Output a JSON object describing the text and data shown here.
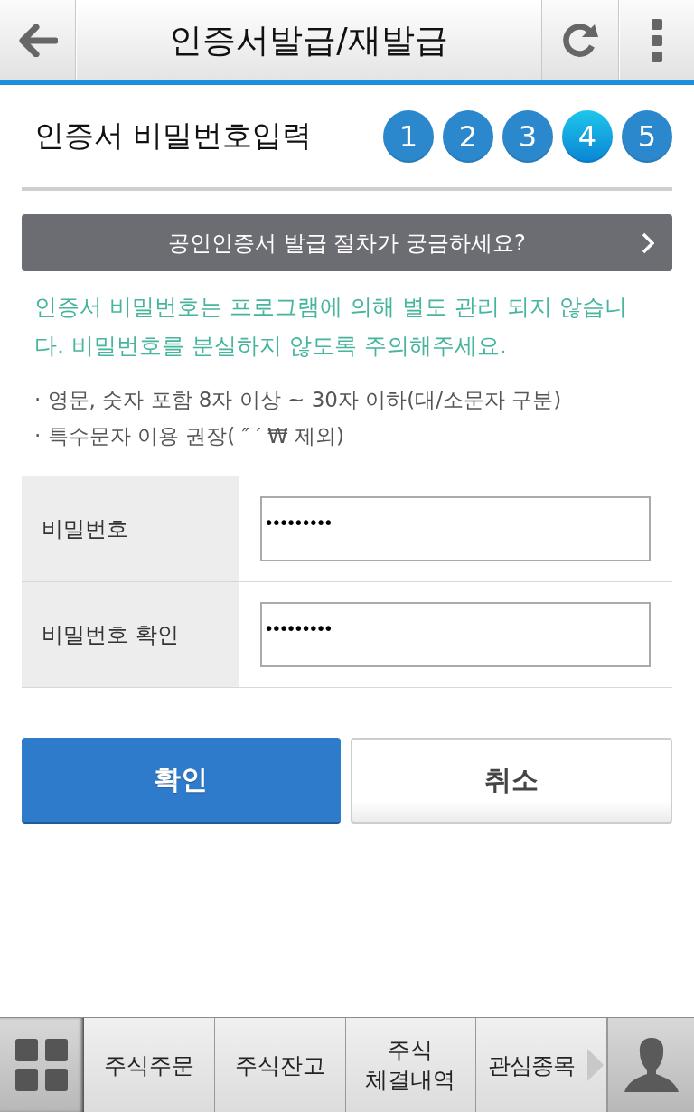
{
  "header": {
    "title": "인증서발급/재발급"
  },
  "section": {
    "title": "인증서 비밀번호입력",
    "steps": [
      {
        "label": "1",
        "selected": false
      },
      {
        "label": "2",
        "selected": false
      },
      {
        "label": "3",
        "selected": false
      },
      {
        "label": "4",
        "selected": true
      },
      {
        "label": "5",
        "selected": false
      }
    ]
  },
  "help_banner": {
    "label": "공인인증서 발급 절차가 궁금하세요?"
  },
  "notice": "인증서 비밀번호는 프로그램에 의해 별도 관리 되지 않습니다. 비밀번호를 분실하지 않도록 주의해주세요.",
  "rules": [
    "· 영문, 숫자 포함 8자 이상 ~ 30자 이하(대/소문자 구분)",
    "· 특수문자 이용 권장( ″ ′ ₩ 제외)"
  ],
  "fields": [
    {
      "label": "비밀번호",
      "value": "•••••••••"
    },
    {
      "label": "비밀번호 확인",
      "value": "•••••••••"
    }
  ],
  "buttons": [
    {
      "label": "확인",
      "kind": "primary"
    },
    {
      "label": "취소",
      "kind": "secondary"
    }
  ],
  "bottom_nav": {
    "items": [
      {
        "label": "주식주문",
        "more": false
      },
      {
        "label": "주식잔고",
        "more": false
      },
      {
        "label": "주식 체결내역",
        "more": false
      },
      {
        "label": "관심종목",
        "more": true
      }
    ]
  }
}
